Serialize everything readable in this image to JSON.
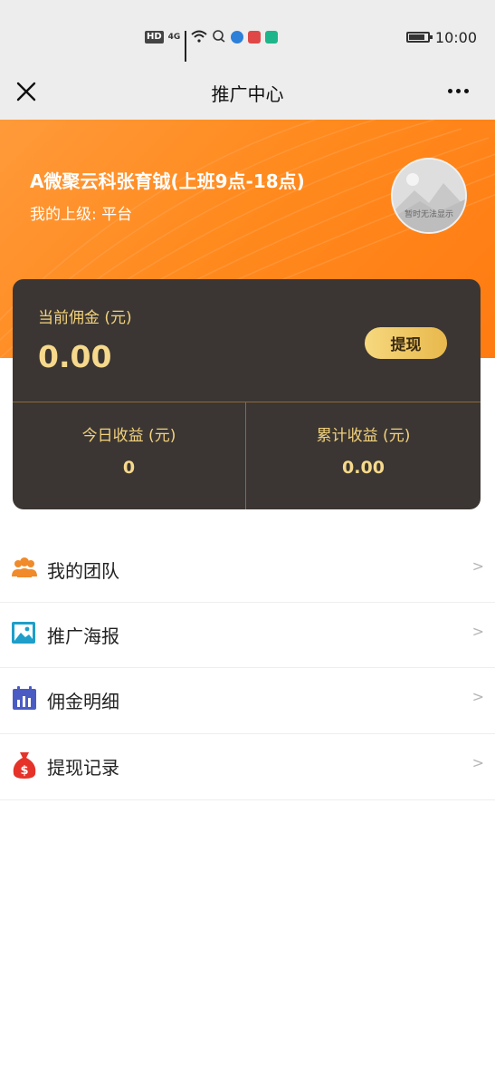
{
  "status_bar": {
    "hd": "HD",
    "network": "4G",
    "time": "10:00"
  },
  "navbar": {
    "title": "推广中心"
  },
  "profile": {
    "username": "A微聚云科张育钺(上班9点-18点)",
    "superior": "我的上级: 平台",
    "avatar_placeholder": "暂时无法显示"
  },
  "commission": {
    "current_label": "当前佣金 (元)",
    "current_value": "0.00",
    "withdraw_label": "提现",
    "today_label": "今日收益 (元)",
    "today_value": "0",
    "total_label": "累计收益 (元)",
    "total_value": "0.00"
  },
  "menu": [
    {
      "label": "我的团队",
      "icon": "team-icon",
      "color": "#f08a2a"
    },
    {
      "label": "推广海报",
      "icon": "poster-icon",
      "color": "#1e9ec9"
    },
    {
      "label": "佣金明细",
      "icon": "calendar-icon",
      "color": "#4b5bc4"
    },
    {
      "label": "提现记录",
      "icon": "money-bag-icon",
      "color": "#e5332a"
    }
  ],
  "arrow": ">",
  "colors": {
    "banner": "#ff8a1e",
    "card": "#3b3633",
    "gold": "#f3d27c"
  }
}
